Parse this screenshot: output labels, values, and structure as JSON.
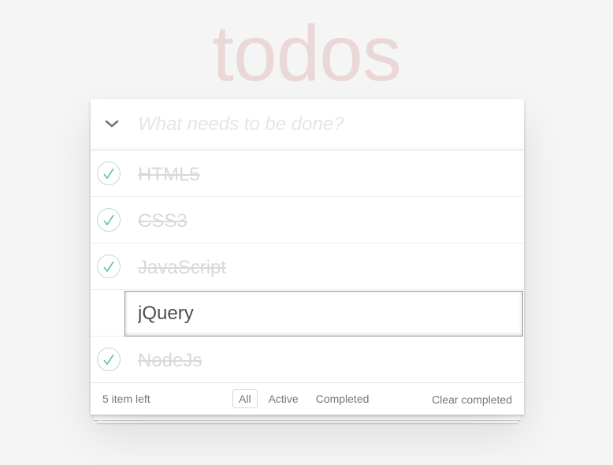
{
  "app": {
    "title": "todos"
  },
  "header": {
    "toggle_all_icon": "chevron-down-icon",
    "new_todo_placeholder": "What needs to be done?",
    "new_todo_value": ""
  },
  "todos": [
    {
      "text": "HTML5",
      "completed": true,
      "editing": false
    },
    {
      "text": "CSS3",
      "completed": true,
      "editing": false
    },
    {
      "text": "JavaScript",
      "completed": true,
      "editing": false
    },
    {
      "text": "jQuery",
      "completed": false,
      "editing": true
    },
    {
      "text": "NodeJs",
      "completed": true,
      "editing": false
    }
  ],
  "footer": {
    "count_label": "5 item left",
    "filters": [
      {
        "label": "All",
        "selected": true
      },
      {
        "label": "Active",
        "selected": false
      },
      {
        "label": "Completed",
        "selected": false
      }
    ],
    "clear_label": "Clear completed"
  },
  "colors": {
    "title": "#ead7d7",
    "check_border": "#bddad5",
    "check_mark": "#5dc2af",
    "completed_text": "#d9d9d9"
  }
}
